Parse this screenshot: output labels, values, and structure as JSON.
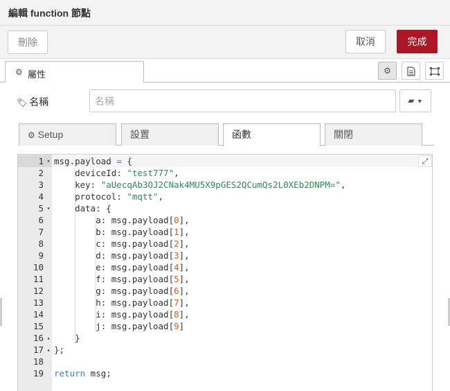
{
  "window": {
    "title": "編輯 function 節點"
  },
  "toolbar": {
    "delete_label": "刪除",
    "cancel_label": "取消",
    "done_label": "完成"
  },
  "tabs": {
    "properties_label": "屬性"
  },
  "name_field": {
    "label": "名稱",
    "placeholder": "名稱",
    "value": ""
  },
  "subtabs": [
    {
      "label": "Setup",
      "active": false
    },
    {
      "label": "設置",
      "active": false
    },
    {
      "label": "函數",
      "active": true
    },
    {
      "label": "關閉",
      "active": false
    }
  ],
  "editor": {
    "active_line": 1,
    "lines": [
      {
        "n": "1",
        "fold": "▾",
        "code": "msg.payload = {"
      },
      {
        "n": "2",
        "fold": "",
        "code": "    deviceId: \"test777\","
      },
      {
        "n": "3",
        "fold": "",
        "code": "    key: \"aUecqAb3OJ2CNak4MU5X9pGES2QCumQs2L0XEb2DNPM=\","
      },
      {
        "n": "4",
        "fold": "",
        "code": "    protocol: \"mqtt\","
      },
      {
        "n": "5",
        "fold": "▾",
        "code": "    data: {"
      },
      {
        "n": "6",
        "fold": "",
        "code": "        a: msg.payload[0],"
      },
      {
        "n": "7",
        "fold": "",
        "code": "        b: msg.payload[1],"
      },
      {
        "n": "8",
        "fold": "",
        "code": "        c: msg.payload[2],"
      },
      {
        "n": "9",
        "fold": "",
        "code": "        d: msg.payload[3],"
      },
      {
        "n": "10",
        "fold": "",
        "code": "        e: msg.payload[4],"
      },
      {
        "n": "11",
        "fold": "",
        "code": "        f: msg.payload[5],"
      },
      {
        "n": "12",
        "fold": "",
        "code": "        g: msg.payload[6],"
      },
      {
        "n": "13",
        "fold": "",
        "code": "        h: msg.payload[7],"
      },
      {
        "n": "14",
        "fold": "",
        "code": "        i: msg.payload[8],"
      },
      {
        "n": "15",
        "fold": "",
        "code": "        j: msg.payload[9]"
      },
      {
        "n": "16",
        "fold": "▴",
        "code": "    }"
      },
      {
        "n": "17",
        "fold": "▴",
        "code": "};"
      },
      {
        "n": "18",
        "fold": "",
        "code": ""
      },
      {
        "n": "19",
        "fold": "",
        "code": "return msg;"
      }
    ]
  },
  "icons": {
    "properties": "gear-icon",
    "name_label": "tag-icon",
    "side": [
      "gear-icon",
      "description-icon",
      "appearance-icon"
    ],
    "library": "book-icon",
    "expand": "expand-icon"
  },
  "colors": {
    "accent": "#ad1625"
  }
}
